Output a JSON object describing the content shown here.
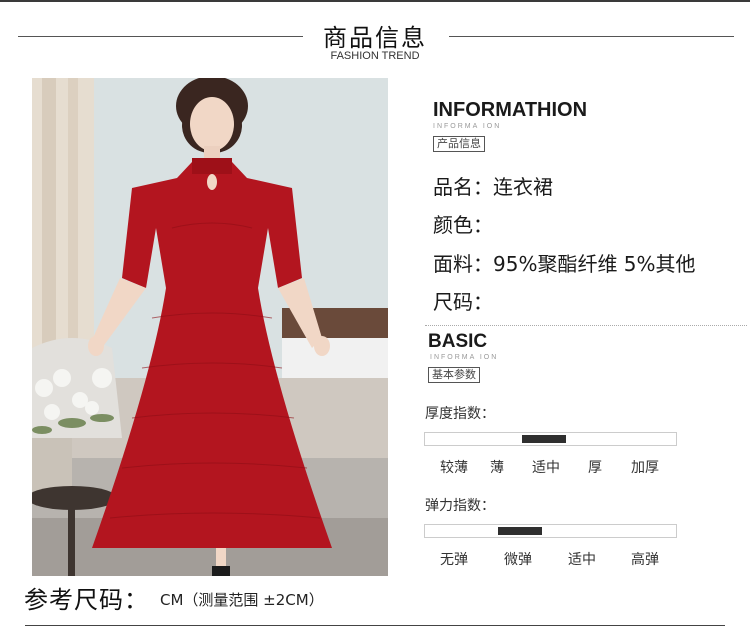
{
  "header": {
    "title": "商品信息",
    "subtitle": "FASHION TREND"
  },
  "info": {
    "title": "INFORMATHION",
    "faint_text": "INFORMA ION",
    "tag": "产品信息",
    "fields": [
      {
        "text": "品名：连衣裙"
      },
      {
        "text": "颜色："
      },
      {
        "text": "面料：95%聚酯纤维 5%其他"
      },
      {
        "text": "尺码："
      }
    ]
  },
  "basic": {
    "title": "BASIC",
    "faint_text": "INFORMA ION",
    "tag": "基本参数",
    "thickness": {
      "label": "厚度指数：",
      "options": [
        "较薄",
        "薄",
        "适中",
        "厚",
        "加厚"
      ],
      "selected_index": 2
    },
    "elasticity": {
      "label": "弹力指数：",
      "options": [
        "无弹",
        "微弹",
        "适中",
        "高弹"
      ],
      "selected_index": 1.4
    }
  },
  "size_reference": {
    "label": "参考尺码：",
    "note": "CM（测量范围 ±2CM）"
  },
  "colors": {
    "dress": "#b3151f",
    "bar_fill": "#2f2f2f"
  }
}
